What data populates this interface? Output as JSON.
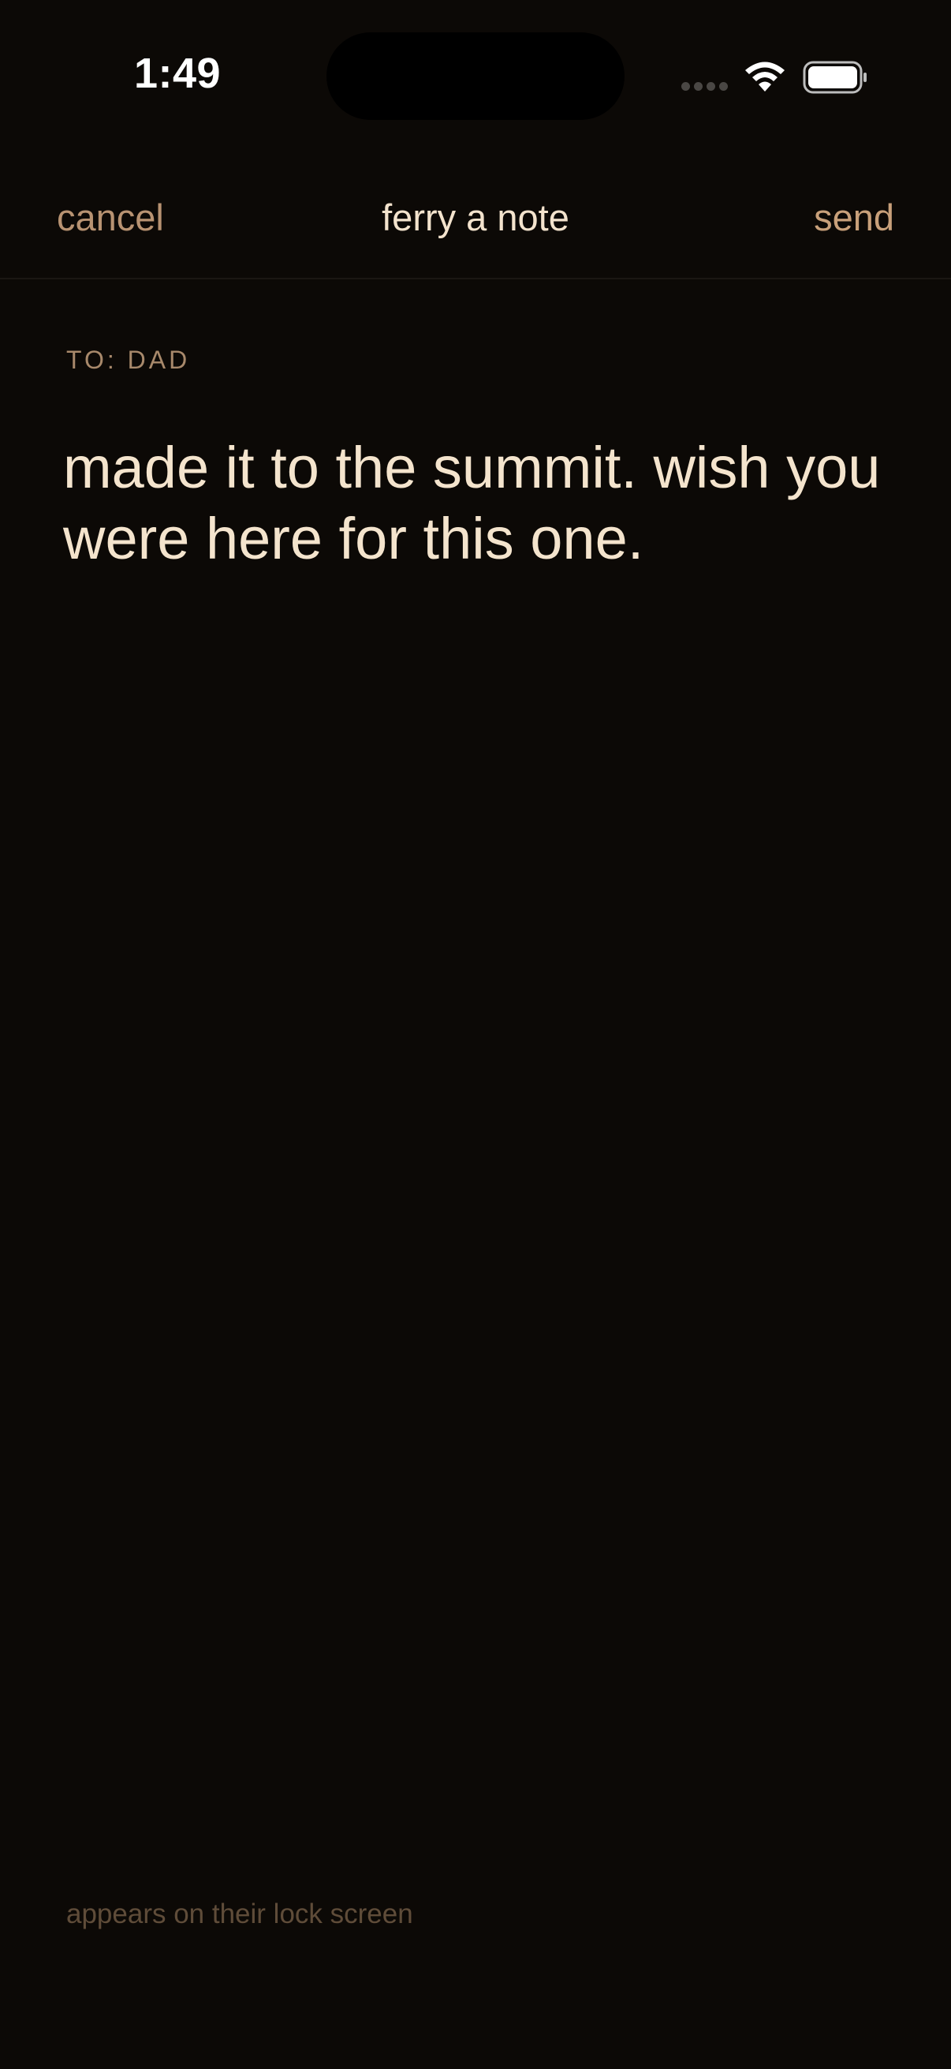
{
  "status_bar": {
    "time": "1:49",
    "icons": [
      "signal-dots-icon",
      "wifi-icon",
      "battery-icon"
    ]
  },
  "nav": {
    "cancel_label": "cancel",
    "title": "ferry a note",
    "send_label": "send"
  },
  "compose": {
    "recipient_label": "TO: DAD",
    "body_text": "made it to the summit. wish you were here for this one.",
    "footer_hint": "appears on their lock screen"
  },
  "colors": {
    "background": "#0c0906",
    "accent": "#c8a07a",
    "text_primary": "#f4e4cd",
    "text_muted": "#5f4c39"
  }
}
